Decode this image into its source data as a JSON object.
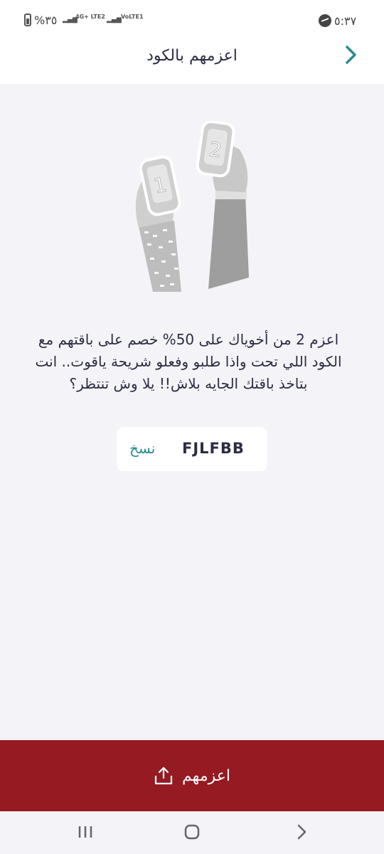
{
  "status_bar": {
    "time": "٥:٣٧",
    "battery": "%٣٥",
    "sim1_net": "VoLTE1",
    "sim2_net": "4G+ LTE2",
    "message_icon": "messenger-icon"
  },
  "header": {
    "title": "اعزمهم بالكود",
    "back_icon": "chevron-right-icon"
  },
  "illustration": {
    "phone_left_number": "1",
    "phone_right_number": "2"
  },
  "message": "اعزم 2 من أخوياك على 50% خصم على باقتهم مع الكود اللي تحت واذا طلبو وفعلو شريحة ياقوت.. انت بتاخذ باقتك الجايه بلاش!! يلا وش تنتظر؟",
  "code_box": {
    "code": "FJLFBB",
    "copy_label": "نسخ"
  },
  "cta": {
    "label": "اعزمهم",
    "icon": "share-upload-icon"
  },
  "colors": {
    "accent": "#961a22",
    "link": "#2a8a8e",
    "text": "#2c2c44",
    "background": "#f4f4f8"
  }
}
